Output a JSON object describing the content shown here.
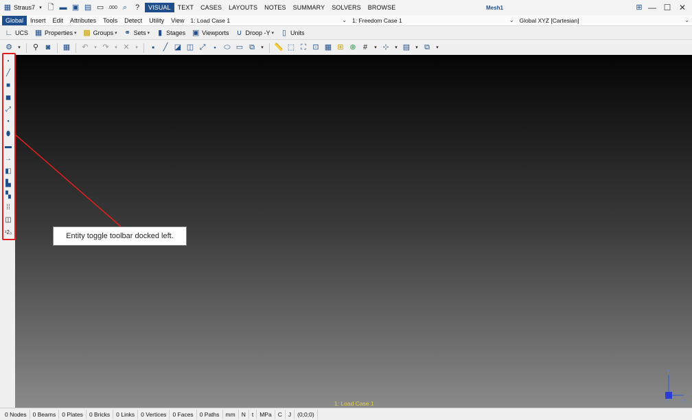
{
  "app": {
    "name": "Straus7",
    "document_title": "Mesh1"
  },
  "ribbon_tabs": [
    "VISUAL",
    "TEXT",
    "CASES",
    "LAYOUTS",
    "NOTES",
    "SUMMARY",
    "SOLVERS",
    "BROWSE"
  ],
  "ribbon_active_tab": "VISUAL",
  "menus": [
    "Global",
    "Insert",
    "Edit",
    "Attributes",
    "Tools",
    "Detect",
    "Utility",
    "View"
  ],
  "menu_active": "Global",
  "selectors": {
    "load_case": "1: Load Case 1",
    "freedom_case": "1: Freedom Case 1",
    "coordinate_system": "Global XYZ [Cartesian]"
  },
  "toolbar1": {
    "ucs": "UCS",
    "properties": "Properties",
    "groups": "Groups",
    "sets": "Sets",
    "stages": "Stages",
    "viewports": "Viewports",
    "droop": "Droop -Y",
    "units": "Units"
  },
  "viewport": {
    "load_case_label": "1: Load Case 1",
    "triad": {
      "y": "Y",
      "z": "Z",
      "x": "X"
    },
    "colors": {
      "top": "#050505",
      "bottom": "#8a8a8a",
      "label": "#e8d23a"
    }
  },
  "callout": {
    "text": "Entity toggle toolbar docked left.",
    "highlight_color": "#e02020"
  },
  "left_toolbar_icons": [
    "node-toggle-icon",
    "beam-toggle-icon",
    "plate-toggle-icon",
    "brick-toggle-icon",
    "link-toggle-icon",
    "vertex-toggle-icon",
    "face-toggle-icon",
    "path-toggle-icon",
    "load-path-toggle-icon",
    "attribute-toggle-icon",
    "load-toggle-icon",
    "restraint-toggle-icon",
    "grid-toggle-icon",
    "label-toggle-icon",
    "numbering-toggle-icon"
  ],
  "status": {
    "nodes": "0 Nodes",
    "beams": "0 Beams",
    "plates": "0 Plates",
    "bricks": "0 Bricks",
    "links": "0 Links",
    "vertices": "0 Vertices",
    "faces": "0 Faces",
    "paths": "0 Paths",
    "unit_length": "mm",
    "unit_force": "N",
    "unit_mass": "t",
    "unit_stress": "MPa",
    "unit_temp": "C",
    "unit_energy": "J",
    "coords": "(0;0;0)"
  },
  "accent_color": "#1f4e8c"
}
